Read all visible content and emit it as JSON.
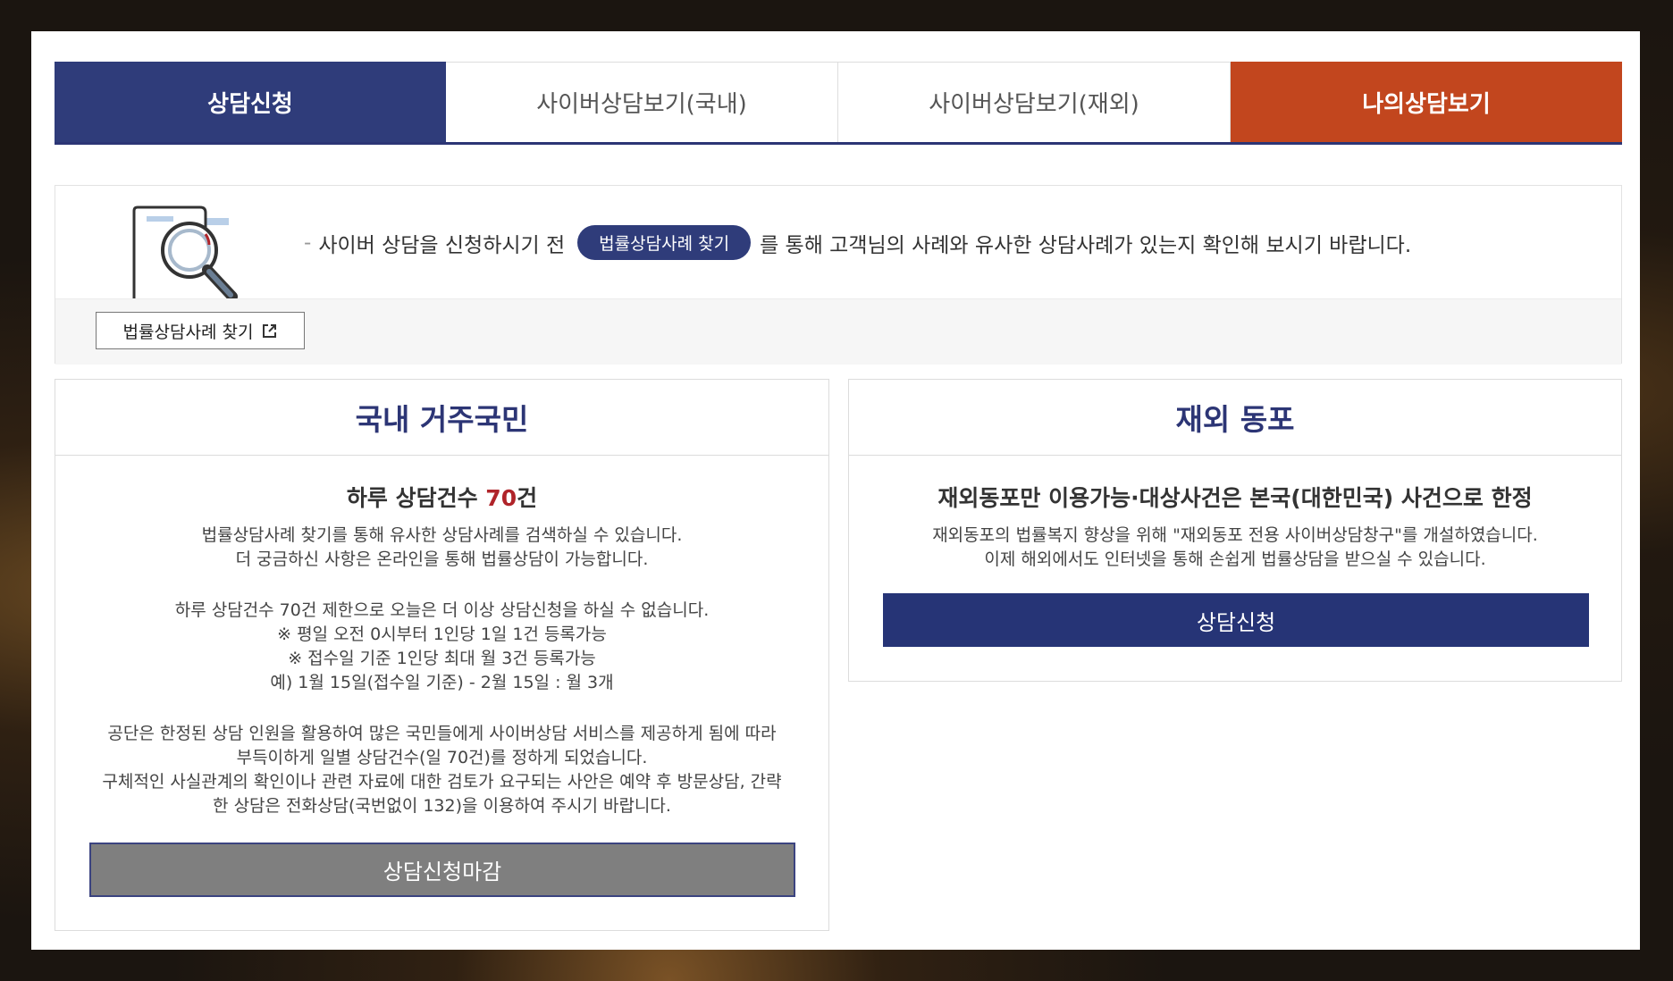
{
  "tabs": [
    {
      "label": "상담신청",
      "state": "active"
    },
    {
      "label": "사이버상담보기(국내)",
      "state": "normal"
    },
    {
      "label": "사이버상담보기(재외)",
      "state": "normal"
    },
    {
      "label": "나의상담보기",
      "state": "highlight"
    }
  ],
  "notice": {
    "dash": "-",
    "text_before": "사이버 상담을 신청하시기 전",
    "pill_label": "법률상담사례 찾기",
    "text_after": "를 통해 고객님의 사례와 유사한 상담사례가 있는지 확인해 보시기 바랍니다.",
    "search_button_label": "법률상담사례 찾기"
  },
  "domestic": {
    "title": "국내 거주국민",
    "lead_prefix": "하루 상담건수 ",
    "lead_count": "70",
    "lead_suffix": "건",
    "lines_a": [
      "법률상담사례 찾기를 통해 유사한 상담사례를 검색하실 수 있습니다.",
      "더 궁금하신 사항은 온라인을 통해 법률상담이 가능합니다."
    ],
    "lines_b": [
      "하루 상담건수 70건 제한으로 오늘은 더 이상 상담신청을 하실 수 없습니다.",
      "※ 평일 오전 0시부터 1인당 1일 1건 등록가능",
      "※ 접수일 기준 1인당 최대 월 3건 등록가능",
      "예) 1월 15일(접수일 기준) - 2월 15일 : 월 3개"
    ],
    "lines_c": [
      "공단은 한정된 상담 인원을 활용하여 많은 국민들에게 사이버상담 서비스를 제공하게 됨에 따라",
      "부득이하게 일별 상담건수(일 70건)를 정하게 되었습니다.",
      "구체적인 사실관계의 확인이나 관련 자료에 대한 검토가 요구되는 사안은 예약 후 방문상담, 간략",
      "한 상담은 전화상담(국번없이 132)을 이용하여 주시기 바랍니다."
    ],
    "button_label": "상담신청마감"
  },
  "overseas": {
    "title": "재외 동포",
    "lead": "재외동포만 이용가능·대상사건은 본국(대한민국) 사건으로 한정",
    "lines": [
      "재외동포의 법률복지 향상을 위해 \"재외동포 전용 사이버상담창구\"를 개설하였습니다.",
      "이제 해외에서도 인터넷을 통해 손쉽게 법률상담을 받으실 수 있습니다."
    ],
    "button_label": "상담신청"
  },
  "colors": {
    "tab_active": "#2f3c7a",
    "tab_mine": "#c2461e",
    "accent_red": "#b0242a",
    "button_navy": "#263476",
    "button_closed": "#7f7f7f"
  },
  "icons": {
    "illustration": "document-magnifier-icon",
    "external": "external-link-icon"
  }
}
